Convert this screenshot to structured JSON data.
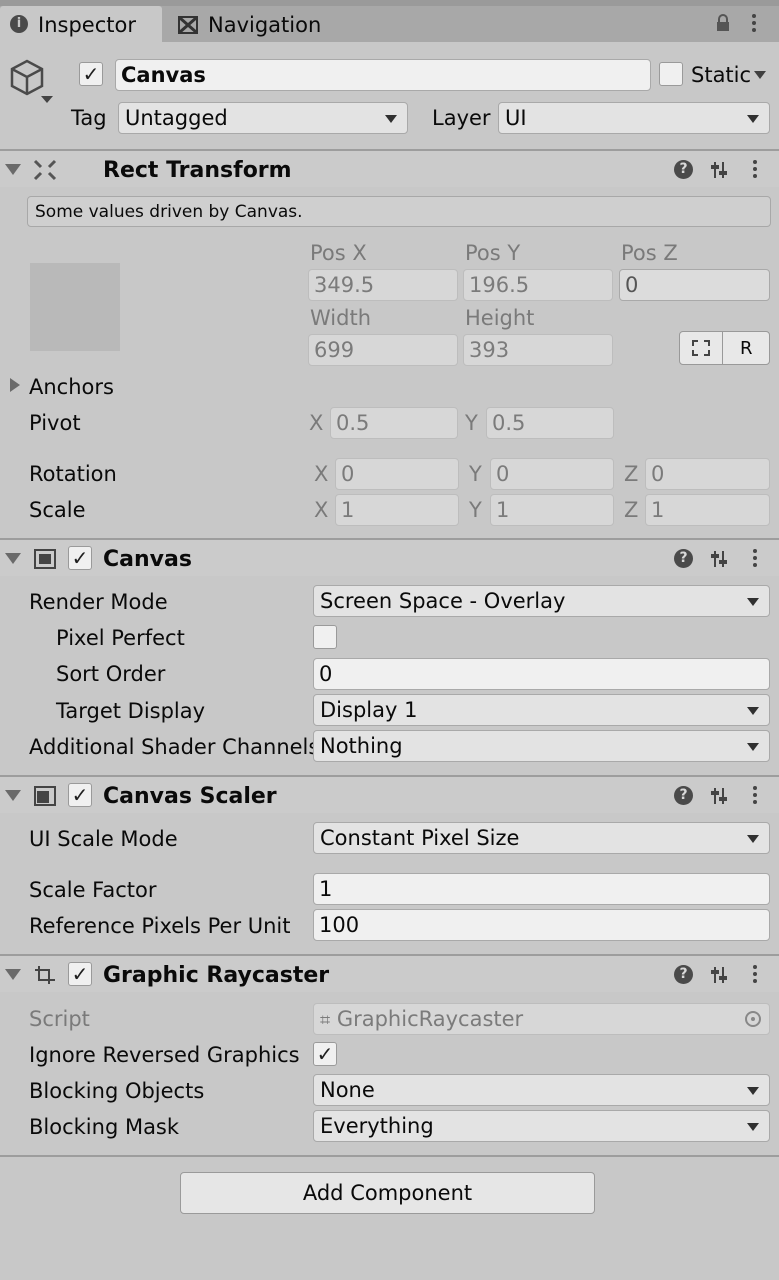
{
  "tabs": {
    "inspector": "Inspector",
    "navigation": "Navigation"
  },
  "object": {
    "name": "Canvas",
    "static_label": "Static",
    "tag_label": "Tag",
    "tag_value": "Untagged",
    "layer_label": "Layer",
    "layer_value": "UI"
  },
  "rect_transform": {
    "title": "Rect Transform",
    "info": "Some values driven by Canvas.",
    "pos_x_label": "Pos X",
    "pos_y_label": "Pos Y",
    "pos_z_label": "Pos Z",
    "pos_x": "349.5",
    "pos_y": "196.5",
    "pos_z": "0",
    "width_label": "Width",
    "height_label": "Height",
    "width": "699",
    "height": "393",
    "r_button": "R",
    "anchors_label": "Anchors",
    "pivot_label": "Pivot",
    "pivot_x": "0.5",
    "pivot_y": "0.5",
    "rotation_label": "Rotation",
    "rot_x": "0",
    "rot_y": "0",
    "rot_z": "0",
    "scale_label": "Scale",
    "scale_x": "1",
    "scale_y": "1",
    "scale_z": "1",
    "x": "X",
    "y": "Y",
    "z": "Z"
  },
  "canvas": {
    "title": "Canvas",
    "render_mode_label": "Render Mode",
    "render_mode": "Screen Space - Overlay",
    "pixel_perfect_label": "Pixel Perfect",
    "sort_order_label": "Sort Order",
    "sort_order": "0",
    "target_display_label": "Target Display",
    "target_display": "Display 1",
    "shader_channels_label": "Additional Shader Channels",
    "shader_channels": "Nothing"
  },
  "canvas_scaler": {
    "title": "Canvas Scaler",
    "ui_scale_mode_label": "UI Scale Mode",
    "ui_scale_mode": "Constant Pixel Size",
    "scale_factor_label": "Scale Factor",
    "scale_factor": "1",
    "ref_pixels_label": "Reference Pixels Per Unit",
    "ref_pixels": "100"
  },
  "graphic_raycaster": {
    "title": "Graphic Raycaster",
    "script_label": "Script",
    "script_value": "GraphicRaycaster",
    "ignore_reversed_label": "Ignore Reversed Graphics",
    "blocking_objects_label": "Blocking Objects",
    "blocking_objects": "None",
    "blocking_mask_label": "Blocking Mask",
    "blocking_mask": "Everything"
  },
  "add_component": "Add Component"
}
